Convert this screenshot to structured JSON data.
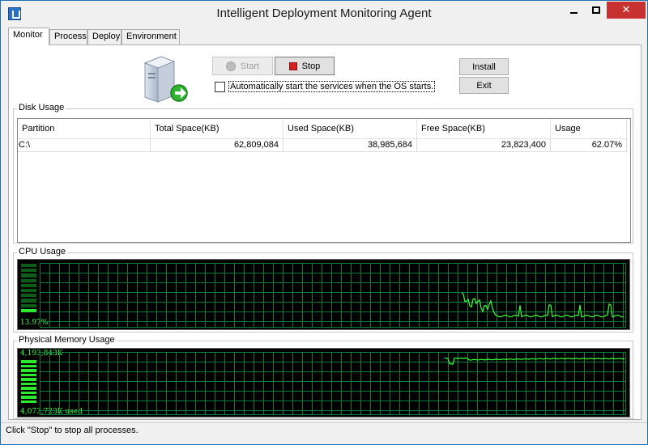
{
  "window": {
    "title": "Intelligent Deployment Monitoring Agent",
    "close_glyph": "✕"
  },
  "tabs": [
    {
      "label": "Monitor"
    },
    {
      "label": "Process"
    },
    {
      "label": "Deploy"
    },
    {
      "label": "Environment"
    }
  ],
  "service": {
    "icon": "server-add-icon",
    "start_label": "Start",
    "stop_label": "Stop",
    "autostart_label": "Automatically start the services when the OS starts.",
    "autostart_checked": false,
    "install_label": "Install",
    "exit_label": "Exit"
  },
  "disk": {
    "group_label": "Disk Usage",
    "columns": [
      "Partition",
      "Total Space(KB)",
      "Used Space(KB)",
      "Free Space(KB)",
      "Usage"
    ],
    "rows": [
      [
        "C:\\",
        "62,809,084",
        "38,985,684",
        "23,823,400",
        "62.07%"
      ]
    ]
  },
  "cpu": {
    "group_label": "CPU Usage",
    "percent_text": "13.97%",
    "level": 0.1397,
    "colors": {
      "grid": "#0b7d3a",
      "line": "#35ff35",
      "meter_on": "#2ee82e",
      "meter_off": "#0d5c18"
    }
  },
  "memory": {
    "group_label": "Physical Memory Usage",
    "total_text": "4,193,843K",
    "used_text": "4,073,723K used",
    "level": 0.9714
  },
  "status": {
    "message": "Click \"Stop\" to stop all processes."
  }
}
